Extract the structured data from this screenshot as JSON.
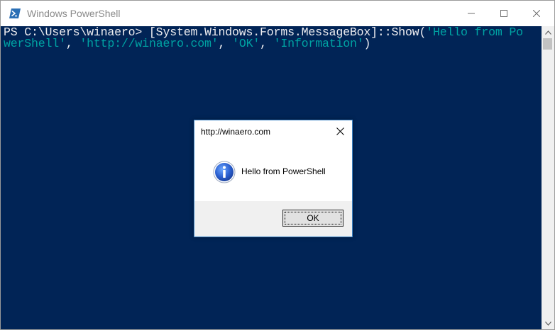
{
  "window": {
    "title": "Windows PowerShell",
    "controls": {
      "minimize": "minimize-icon",
      "maximize": "maximize-icon",
      "close": "close-icon"
    }
  },
  "console": {
    "line1": {
      "prompt": "PS C:\\Users\\winaero> ",
      "command": "[System.Windows.Forms.MessageBox]::Show(",
      "arg1_part": "'Hello from Po"
    },
    "line2": {
      "arg1_rest": "werShell'",
      "sep1": ", ",
      "arg2": "'http://winaero.com'",
      "sep2": ", ",
      "arg3": "'OK'",
      "sep3": ", ",
      "arg4": "'Information'",
      "close": ")"
    }
  },
  "dialog": {
    "title": "http://winaero.com",
    "message": "Hello from PowerShell",
    "icon": "information-icon",
    "ok_label": "OK"
  },
  "colors": {
    "console_bg": "#012456",
    "console_text": "#eeedf0",
    "string_text": "#00a3a3",
    "dialog_border": "#3f86c8"
  }
}
